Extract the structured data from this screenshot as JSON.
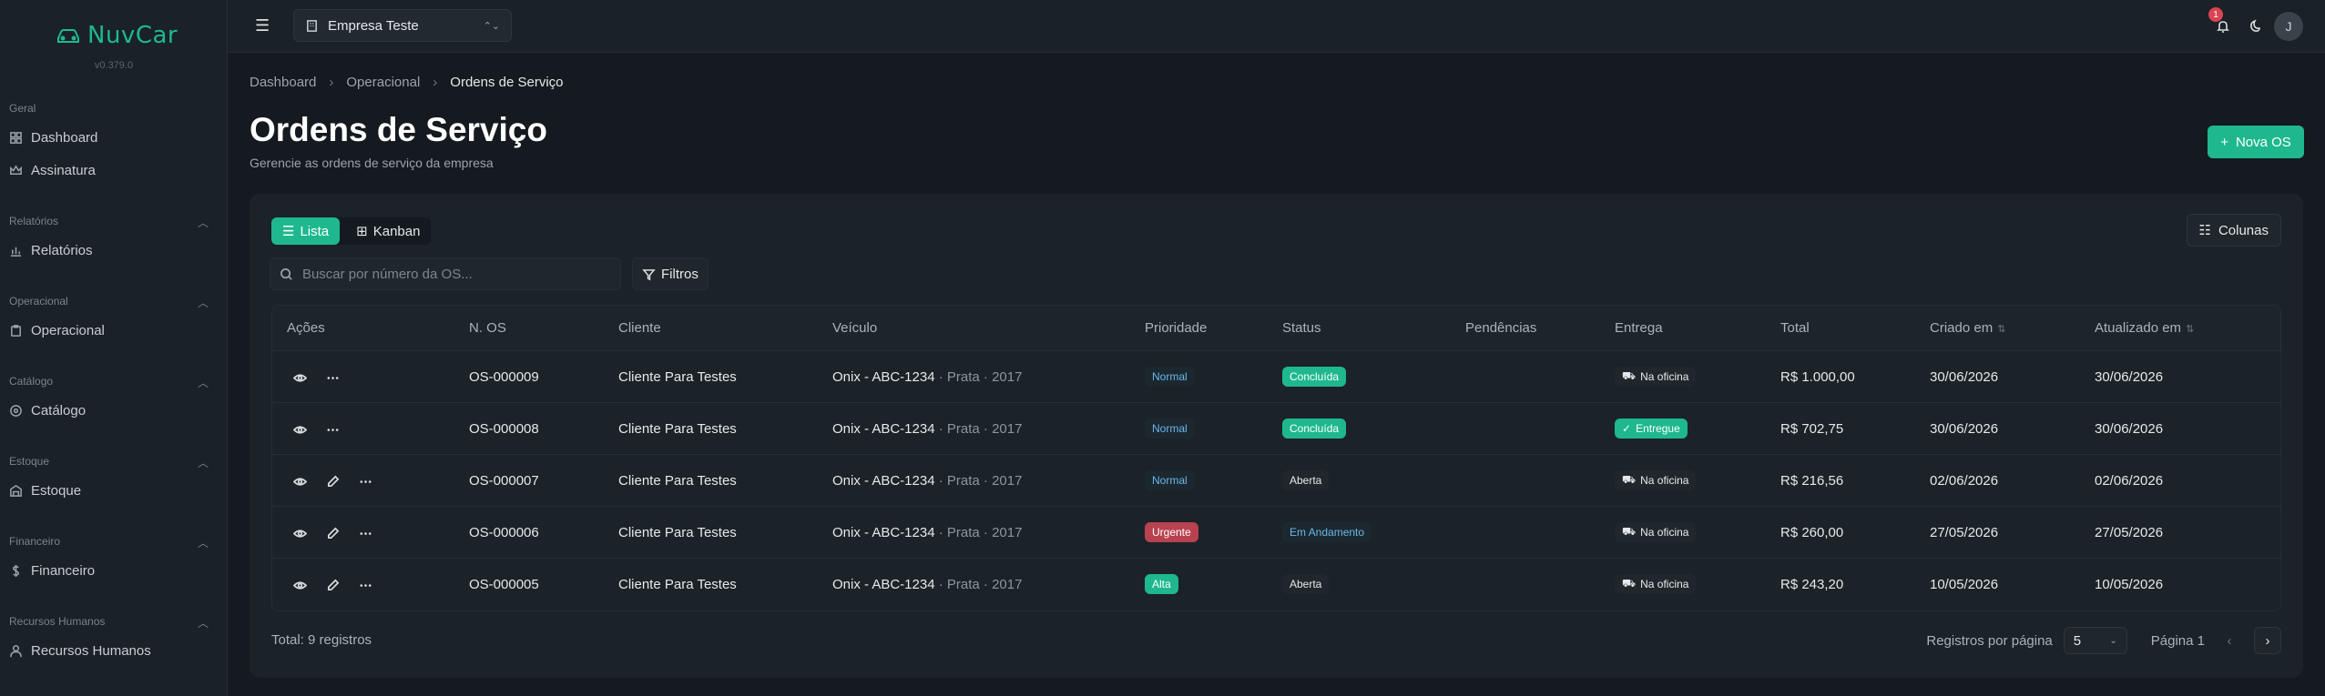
{
  "app": {
    "name": "NuvCar",
    "version": "v0.379.0"
  },
  "sidebar": {
    "groups": [
      {
        "label": "Geral",
        "items": [
          {
            "label": "Dashboard",
            "icon": "dashboard-icon"
          },
          {
            "label": "Assinatura",
            "icon": "crown-icon"
          }
        ]
      },
      {
        "label": "Relatórios",
        "items": [
          {
            "label": "Relatórios",
            "icon": "bar-chart-icon"
          }
        ]
      },
      {
        "label": "Operacional",
        "items": [
          {
            "label": "Operacional",
            "icon": "clipboard-icon"
          }
        ]
      },
      {
        "label": "Catálogo",
        "items": [
          {
            "label": "Catálogo",
            "icon": "catalog-icon"
          }
        ]
      },
      {
        "label": "Estoque",
        "items": [
          {
            "label": "Estoque",
            "icon": "warehouse-icon"
          }
        ]
      },
      {
        "label": "Financeiro",
        "items": [
          {
            "label": "Financeiro",
            "icon": "dollar-icon"
          }
        ]
      },
      {
        "label": "Recursos Humanos",
        "items": [
          {
            "label": "Recursos Humanos",
            "icon": "users-icon"
          }
        ]
      }
    ]
  },
  "header": {
    "company": "Empresa Teste",
    "notifications_count": "1",
    "avatar_initial": "J"
  },
  "breadcrumb": [
    "Dashboard",
    "Operacional",
    "Ordens de Serviço"
  ],
  "page": {
    "title": "Ordens de Serviço",
    "subtitle": "Gerencie as ordens de serviço da empresa",
    "new_button": "Nova OS"
  },
  "toolbar": {
    "view_list": "Lista",
    "view_kanban": "Kanban",
    "columns_button": "Colunas",
    "search_placeholder": "Buscar por número da OS...",
    "filters_button": "Filtros"
  },
  "table": {
    "headers": [
      "Ações",
      "N. OS",
      "Cliente",
      "Veículo",
      "Prioridade",
      "Status",
      "Pendências",
      "Entrega",
      "Total",
      "Criado em",
      "Atualizado em"
    ],
    "rows": [
      {
        "os": "OS-000009",
        "cliente": "Cliente Para Testes",
        "veiculo": "Onix - ABC-1234",
        "veiculo_extra": " · Prata · 2017",
        "prioridade": "Normal",
        "status": "Concluída",
        "entrega": "Na oficina",
        "total": "R$ 1.000,00",
        "criado": "30/06/2026",
        "atualizado": "30/06/2026"
      },
      {
        "os": "OS-000008",
        "cliente": "Cliente Para Testes",
        "veiculo": "Onix - ABC-1234",
        "veiculo_extra": " · Prata · 2017",
        "prioridade": "Normal",
        "status": "Concluída",
        "entrega": "Entregue",
        "total": "R$ 702,75",
        "criado": "30/06/2026",
        "atualizado": "30/06/2026"
      },
      {
        "os": "OS-000007",
        "cliente": "Cliente Para Testes",
        "veiculo": "Onix - ABC-1234",
        "veiculo_extra": " · Prata · 2017",
        "prioridade": "Normal",
        "status": "Aberta",
        "entrega": "Na oficina",
        "total": "R$ 216,56",
        "criado": "02/06/2026",
        "atualizado": "02/06/2026"
      },
      {
        "os": "OS-000006",
        "cliente": "Cliente Para Testes",
        "veiculo": "Onix - ABC-1234",
        "veiculo_extra": " · Prata · 2017",
        "prioridade": "Urgente",
        "status": "Em Andamento",
        "entrega": "Na oficina",
        "total": "R$ 260,00",
        "criado": "27/05/2026",
        "atualizado": "27/05/2026"
      },
      {
        "os": "OS-000005",
        "cliente": "Cliente Para Testes",
        "veiculo": "Onix - ABC-1234",
        "veiculo_extra": " · Prata · 2017",
        "prioridade": "Alta",
        "status": "Aberta",
        "entrega": "Na oficina",
        "total": "R$ 243,20",
        "criado": "10/05/2026",
        "atualizado": "10/05/2026"
      }
    ]
  },
  "footer": {
    "total": "Total: 9 registros",
    "per_page_label": "Registros por página",
    "per_page_value": "5",
    "page_label": "Página 1"
  },
  "colors": {
    "accent": "#1fb88e",
    "danger": "#b8424f",
    "info": "#6bb6e8"
  }
}
